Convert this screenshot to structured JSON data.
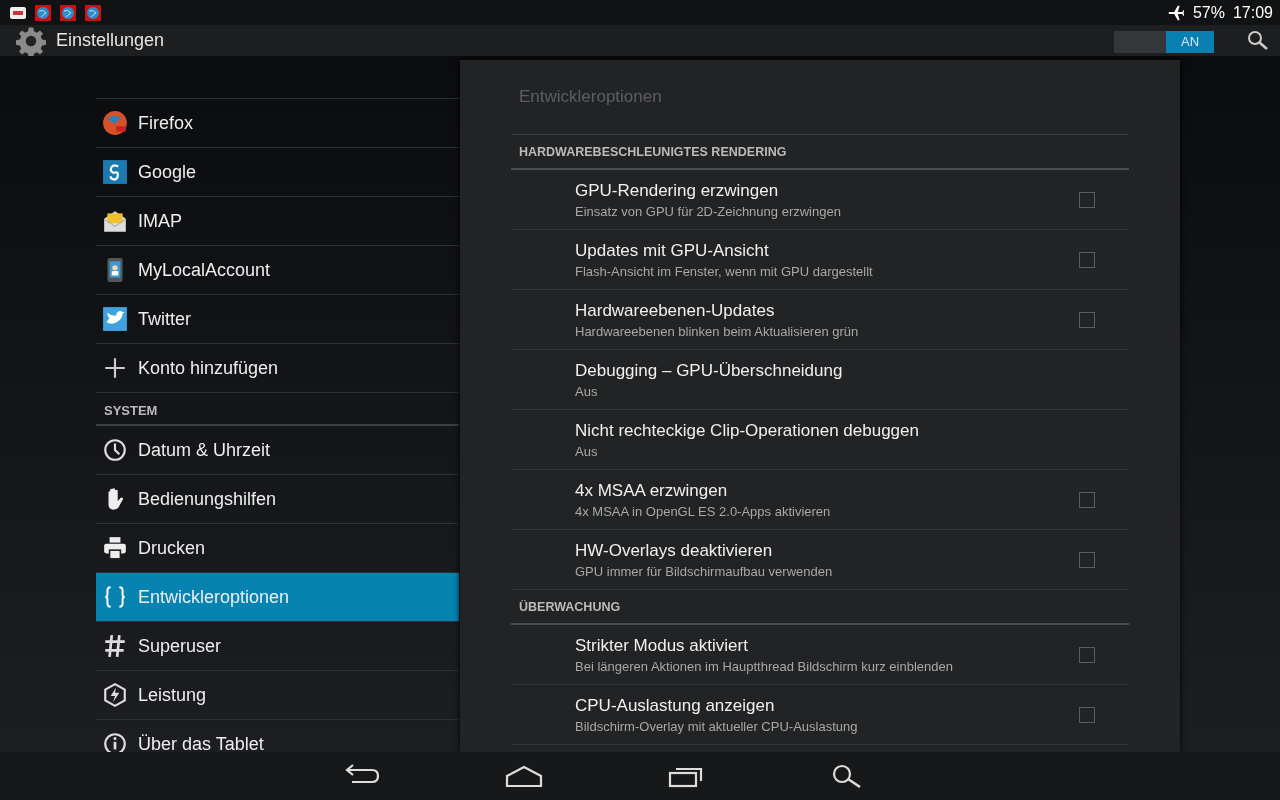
{
  "status_bar": {
    "battery": "57%",
    "time": "17:09"
  },
  "action_bar": {
    "title": "Einstellungen",
    "toggle": {
      "label": "AN",
      "on": true
    }
  },
  "sidebar": {
    "sections": [
      {
        "items": [
          {
            "label": "Firefox",
            "selected": false
          },
          {
            "label": "Google",
            "selected": false
          },
          {
            "label": "IMAP",
            "selected": false
          },
          {
            "label": "MyLocalAccount",
            "selected": false
          },
          {
            "label": "Twitter",
            "selected": false
          },
          {
            "label": "Konto hinzufügen",
            "selected": false
          }
        ]
      },
      {
        "header": "SYSTEM",
        "items": [
          {
            "label": "Datum & Uhrzeit",
            "selected": false
          },
          {
            "label": "Bedienungshilfen",
            "selected": false
          },
          {
            "label": "Drucken",
            "selected": false
          },
          {
            "label": "Entwickleroptionen",
            "selected": true
          },
          {
            "label": "Superuser",
            "selected": false
          },
          {
            "label": "Leistung",
            "selected": false
          },
          {
            "label": "Über das Tablet",
            "selected": false
          }
        ]
      }
    ]
  },
  "panel": {
    "title": "Entwickleroptionen",
    "groups": [
      {
        "header": "HARDWAREBESCHLEUNIGTES RENDERING",
        "rows": [
          {
            "kind": "checkbox",
            "title": "GPU-Rendering erzwingen",
            "subtitle": "Einsatz von GPU für 2D-Zeichnung erzwingen",
            "checked": false
          },
          {
            "kind": "checkbox",
            "title": "Updates mit GPU-Ansicht",
            "subtitle": "Flash-Ansicht im Fenster, wenn mit GPU dargestellt",
            "checked": false
          },
          {
            "kind": "checkbox",
            "title": "Hardwareebenen-Updates",
            "subtitle": "Hardwareebenen blinken beim Aktualisieren grün",
            "checked": false
          },
          {
            "kind": "list",
            "title": "Debugging – GPU-Überschneidung",
            "subtitle": "Aus"
          },
          {
            "kind": "list",
            "title": "Nicht rechteckige Clip-Operationen debuggen",
            "subtitle": "Aus"
          },
          {
            "kind": "checkbox",
            "title": "4x MSAA erzwingen",
            "subtitle": "4x MSAA in OpenGL ES 2.0-Apps aktivieren",
            "checked": false
          },
          {
            "kind": "checkbox",
            "title": "HW-Overlays deaktivieren",
            "subtitle": "GPU immer für Bildschirmaufbau verwenden",
            "checked": false
          }
        ]
      },
      {
        "header": "ÜBERWACHUNG",
        "rows": [
          {
            "kind": "checkbox",
            "title": "Strikter Modus aktiviert",
            "subtitle": "Bei längeren Aktionen im Hauptthread Bildschirm kurz einblenden",
            "checked": false
          },
          {
            "kind": "checkbox",
            "title": "CPU-Auslastung anzeigen",
            "subtitle": "Bildschirm-Overlay mit aktueller CPU-Auslastung",
            "checked": false
          }
        ]
      }
    ]
  }
}
